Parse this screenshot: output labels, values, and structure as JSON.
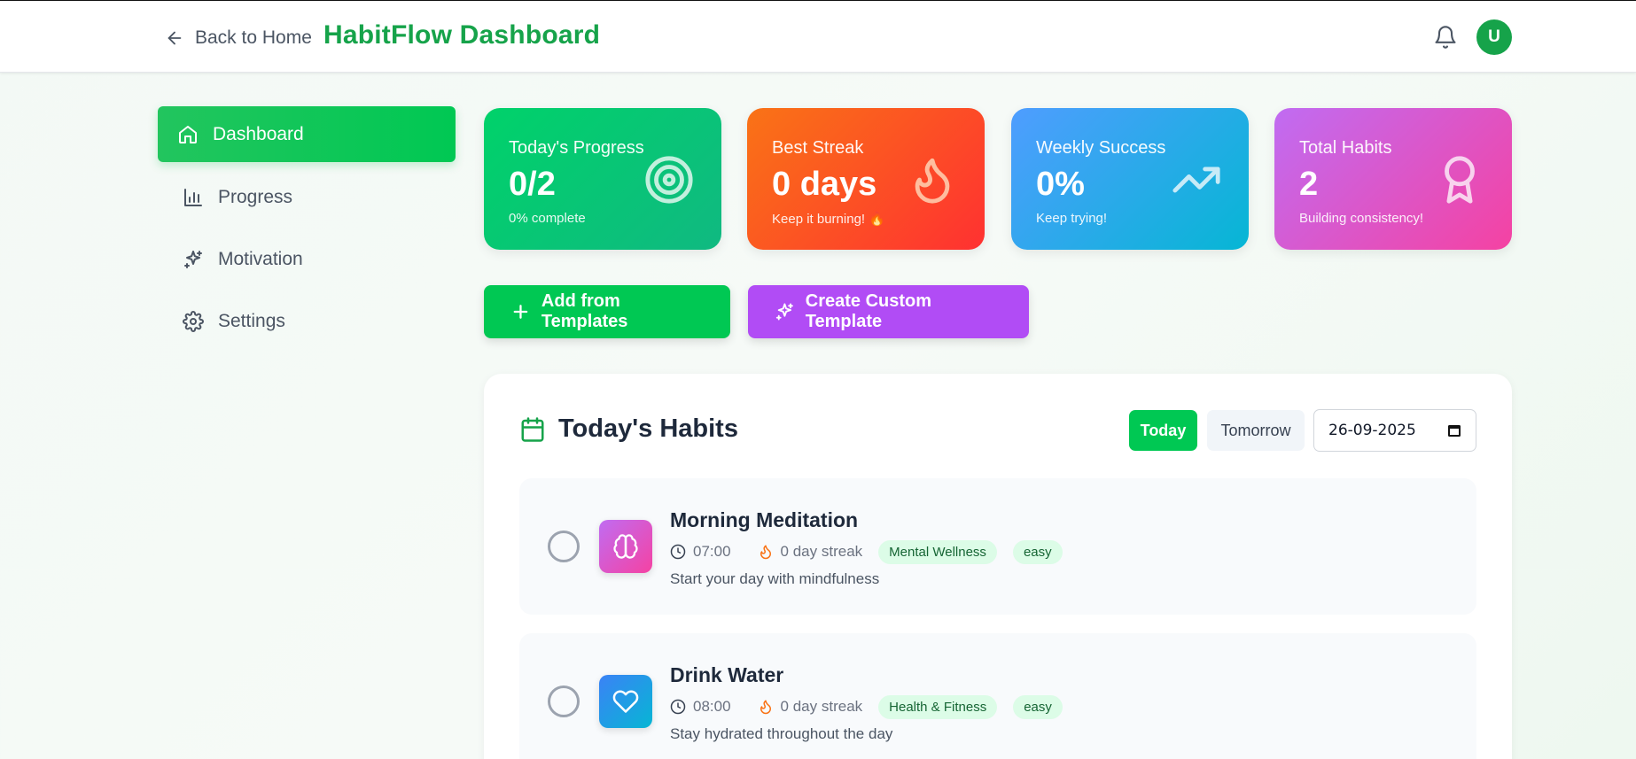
{
  "header": {
    "back_label": "Back to Home",
    "title": "HabitFlow Dashboard",
    "avatar_initial": "U"
  },
  "sidebar": {
    "items": [
      {
        "label": "Dashboard",
        "icon": "home-icon",
        "active": true
      },
      {
        "label": "Progress",
        "icon": "bar-chart-icon",
        "active": false
      },
      {
        "label": "Motivation",
        "icon": "sparkles-icon",
        "active": false
      },
      {
        "label": "Settings",
        "icon": "gear-icon",
        "active": false
      }
    ]
  },
  "stats": {
    "progress": {
      "label": "Today's Progress",
      "value": "0/2",
      "sub": "0% complete",
      "icon": "target-icon"
    },
    "streak": {
      "label": "Best Streak",
      "value": "0 days",
      "sub": "Keep it burning! 🔥",
      "icon": "flame-icon"
    },
    "weekly": {
      "label": "Weekly Success",
      "value": "0%",
      "sub": "Keep trying!",
      "icon": "trending-up-icon"
    },
    "total": {
      "label": "Total Habits",
      "value": "2",
      "sub": "Building consistency!",
      "icon": "award-icon"
    }
  },
  "actions": {
    "add_templates": "Add from Templates",
    "create_custom": "Create Custom Template"
  },
  "habits_panel": {
    "title": "Today's Habits",
    "today_label": "Today",
    "tomorrow_label": "Tomorrow",
    "date_value": "26-09-2025",
    "habits": [
      {
        "name": "Morning Meditation",
        "time": "07:00",
        "streak": "0 day streak",
        "category": "Mental Wellness",
        "difficulty": "easy",
        "description": "Start your day with mindfulness",
        "icon": "brain-icon"
      },
      {
        "name": "Drink Water",
        "time": "08:00",
        "streak": "0 day streak",
        "category": "Health & Fitness",
        "difficulty": "easy",
        "description": "Stay hydrated throughout the day",
        "icon": "heart-icon"
      }
    ]
  },
  "colors": {
    "brand_green": "#16a34a",
    "accent_green": "#00c853",
    "accent_purple": "#b14cf5"
  }
}
